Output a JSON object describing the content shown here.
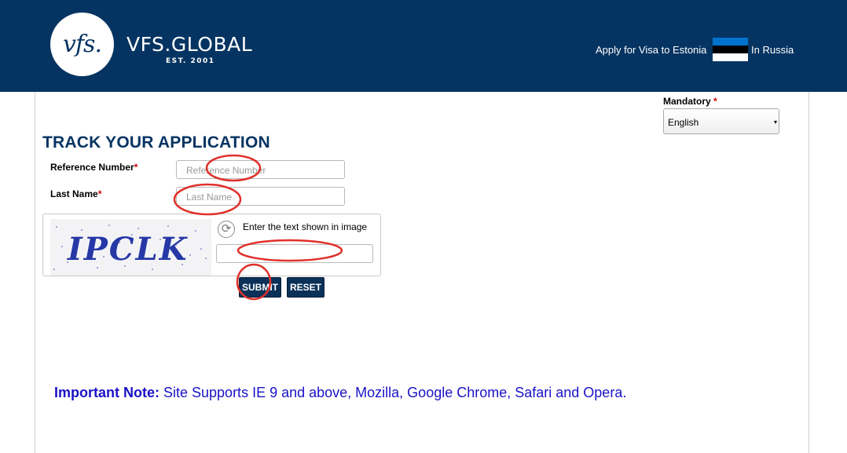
{
  "header": {
    "logo_mark": "vfs.",
    "brand_name": "VFS.GLOBAL",
    "brand_est": "EST. 2001",
    "apply_text": "Apply for Visa to Estonia",
    "country_text": "In Russia",
    "background_color": "#063462",
    "flag_colors": [
      "#0072ce",
      "#000000",
      "#ffffff"
    ]
  },
  "language": {
    "mandatory_label": "Mandatory",
    "required_marker": "*",
    "selected": "English"
  },
  "form": {
    "title": "TRACK YOUR APPLICATION",
    "reference": {
      "label": "Reference Number",
      "required": "*",
      "placeholder": "Reference Number"
    },
    "last_name": {
      "label": "Last Name",
      "required": "*",
      "placeholder": "Last Name"
    },
    "captcha": {
      "image_text": "IPCLK",
      "prompt": "Enter the text shown in image",
      "value": ""
    },
    "submit_label": "SUBMIT",
    "reset_label": "RESET"
  },
  "note": {
    "label": "Important Note:",
    "text": " Site Supports IE 9 and above, Mozilla, Google Chrome, Safari and Opera."
  },
  "annotation_color": "#e0302a"
}
